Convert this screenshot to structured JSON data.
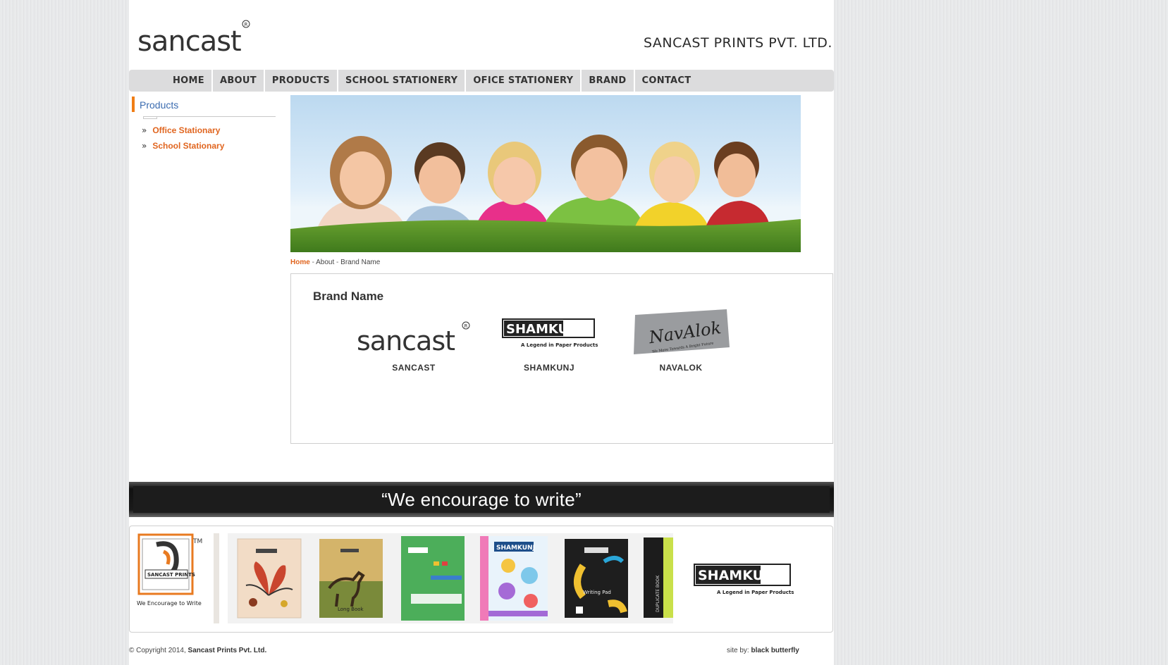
{
  "header": {
    "logo_text": "sancast",
    "company_name": "SANCAST PRINTS PVT. LTD."
  },
  "nav": [
    "HOME",
    "ABOUT",
    "PRODUCTS",
    "SCHOOL STATIONERY",
    "OFICE STATIONERY",
    "BRAND",
    "CONTACT"
  ],
  "sidebar": {
    "title": "Products",
    "bullet": "»",
    "items": [
      "Office Stationary",
      "School Stationary"
    ]
  },
  "breadcrumb": {
    "home": "Home",
    "separator": " - ",
    "about": "About",
    "current": "Brand Name"
  },
  "content": {
    "title": "Brand Name",
    "brands": [
      {
        "name": "SANCAST",
        "logo_text": "sancast"
      },
      {
        "name": "SHAMKUNJ",
        "logo_text": "SHAMKUNJ",
        "tagline": "A Legend in Paper Products"
      },
      {
        "name": "NAVALOK",
        "logo_text": "NavAlok",
        "tagline": "We Move Towards A Bright Future"
      }
    ]
  },
  "slogan": "“We encourage to write”",
  "gallery": {
    "sancast_prints_label": "SANCAST PRINTS",
    "sancast_prints_tagline": "We Encourage to Write",
    "shamkunj_logo": "SHAMKUNJ",
    "shamkunj_tagline": "A Legend in Paper Products",
    "notebook_brand": "SHAMKUNJ",
    "notebook_titles": [
      "Long Book",
      "Writing Pad",
      "DUPLICATE BOOK"
    ]
  },
  "footer": {
    "copyright_prefix": "© Copyright 2014,",
    "copyright_company": "Sancast Prints Pvt. Ltd.",
    "credit_prefix": "site by:",
    "credit_name": "black butterfly"
  },
  "colors": {
    "accent_orange": "#e0651f",
    "sidebar_title_blue": "#3b6cb0",
    "nav_bg": "#dcdcdd"
  }
}
